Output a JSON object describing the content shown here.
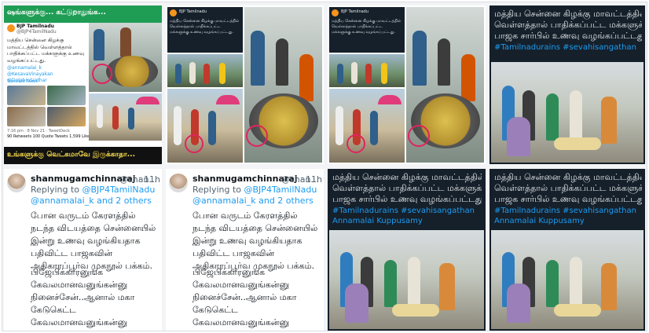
{
  "collage_title": "ஷங்களுக்கு... கட்டுறாதுங்க...",
  "bottom_caption": "உங்களுக்கு வெட்கமாவே இருக்காதா...",
  "small_tweet": {
    "account": "BJP Tamilnadu",
    "handle": "@BJP4TamilNadu",
    "text": "மத்திய சென்னை கிழக்கு மாவட்டத்தில் வெள்ளத்தால் பாதிக்கப்பட்ட மக்களுக்கு உணவு வழங்கப்பட்டது.",
    "mentions": "@annamalai_k @KesavaVinayakan @DolphinSridhar",
    "translate": "Translate Tweet",
    "meta": "7:16 pm · 8 Nov 21 · TweetDeck",
    "stats": "90 Retweets  100 Quote Tweets  1,599 Likes"
  },
  "dark_caption": {
    "line1": "மத்திய சென்னை கிழக்கு மாவட்டத்தில்",
    "line2": "வெள்ளத்தால் பாதிக்கப்பட்ட மக்களுக்கு",
    "line3": "பாஜக சார்பில் உணவு வழங்கப்பட்டது.",
    "hashtags": "#Tamilnadurains  #sevahisangathan",
    "mention": "Annamalai Kuppusamy"
  },
  "reply_tweet": {
    "name": "shanmugamchinnaraj",
    "handle": "@shan...",
    "time": "· 11h",
    "replying_prefix": "Replying to",
    "replying_handle": "@BJP4TamilNadu",
    "replying_more": "@annamalai_k and 2 others",
    "para1": "போன வருடம் கேரளத்தில் நடந்த விடயத்தை சென்னையில் இன்று உணவு வழங்கியதாக பதிவிட்ட பாஜகவின் அதிகாரப்பூர்வ முகநூல் பக்கம்.",
    "para2": "பிஜேபிக்காரனுங்க கேவலமானவனுங்கன்னு நினைச்சேன்..ஆனால் மகா கேடுகெட்ட கேவலமானவனுங்கன்னு நிரூபிச்சிருக்கானுங்க"
  },
  "colors": {
    "dark_bg": "#15202b",
    "link_blue": "#1d9bf0",
    "text": "#0f1419",
    "muted": "#536471",
    "accent_red": "#e0245e"
  },
  "icons": [
    "avatar",
    "bjp-logo",
    "verified-badge"
  ]
}
